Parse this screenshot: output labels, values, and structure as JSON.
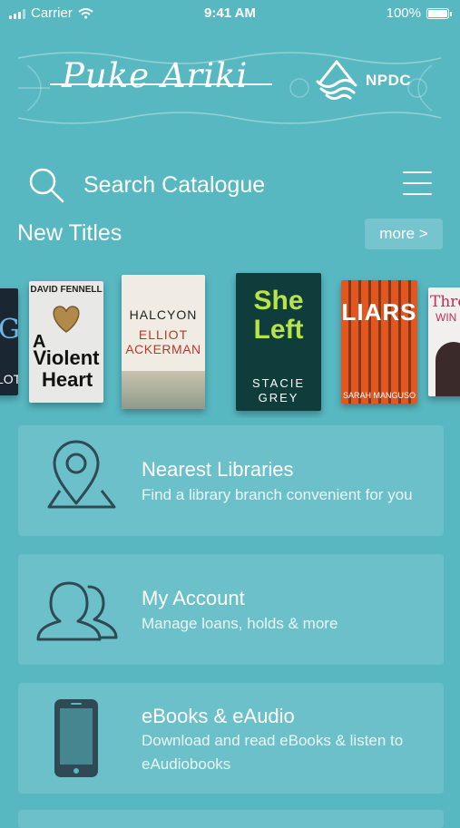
{
  "status_bar": {
    "carrier": "Carrier",
    "time": "9:41 AM",
    "battery": "100%"
  },
  "banner": {
    "brand": "Puke Ariki",
    "partner": "NPDC"
  },
  "search": {
    "placeholder": "Search Catalogue"
  },
  "new_titles": {
    "heading": "New Titles",
    "more_label": "more >",
    "books": [
      {
        "lines": [
          "G",
          "LOT"
        ]
      },
      {
        "lines": [
          "DAVID FENNELL",
          "A",
          "Violent",
          "Heart"
        ]
      },
      {
        "lines": [
          "HALCYON",
          "ELLIOT",
          "ACKERMAN"
        ]
      },
      {
        "lines": [
          "She",
          "Left",
          "STACIE",
          "GREY"
        ]
      },
      {
        "lines": [
          "LIARS",
          "SARAH MANGUSO"
        ]
      },
      {
        "lines": [
          "Thro",
          "WIN"
        ]
      }
    ]
  },
  "cards": [
    {
      "title": "Nearest Libraries",
      "subtitle": "Find a library branch convenient for you",
      "icon": "map-pin-icon"
    },
    {
      "title": "My Account",
      "subtitle": "Manage loans, holds & more",
      "icon": "users-icon"
    },
    {
      "title": "eBooks & eAudio",
      "subtitle": "Download and read eBooks & listen to eAudiobooks",
      "icon": "phone-icon"
    }
  ],
  "colors": {
    "background": "#58b8c2",
    "text": "#ffffff",
    "icon": "#2f4a55"
  }
}
